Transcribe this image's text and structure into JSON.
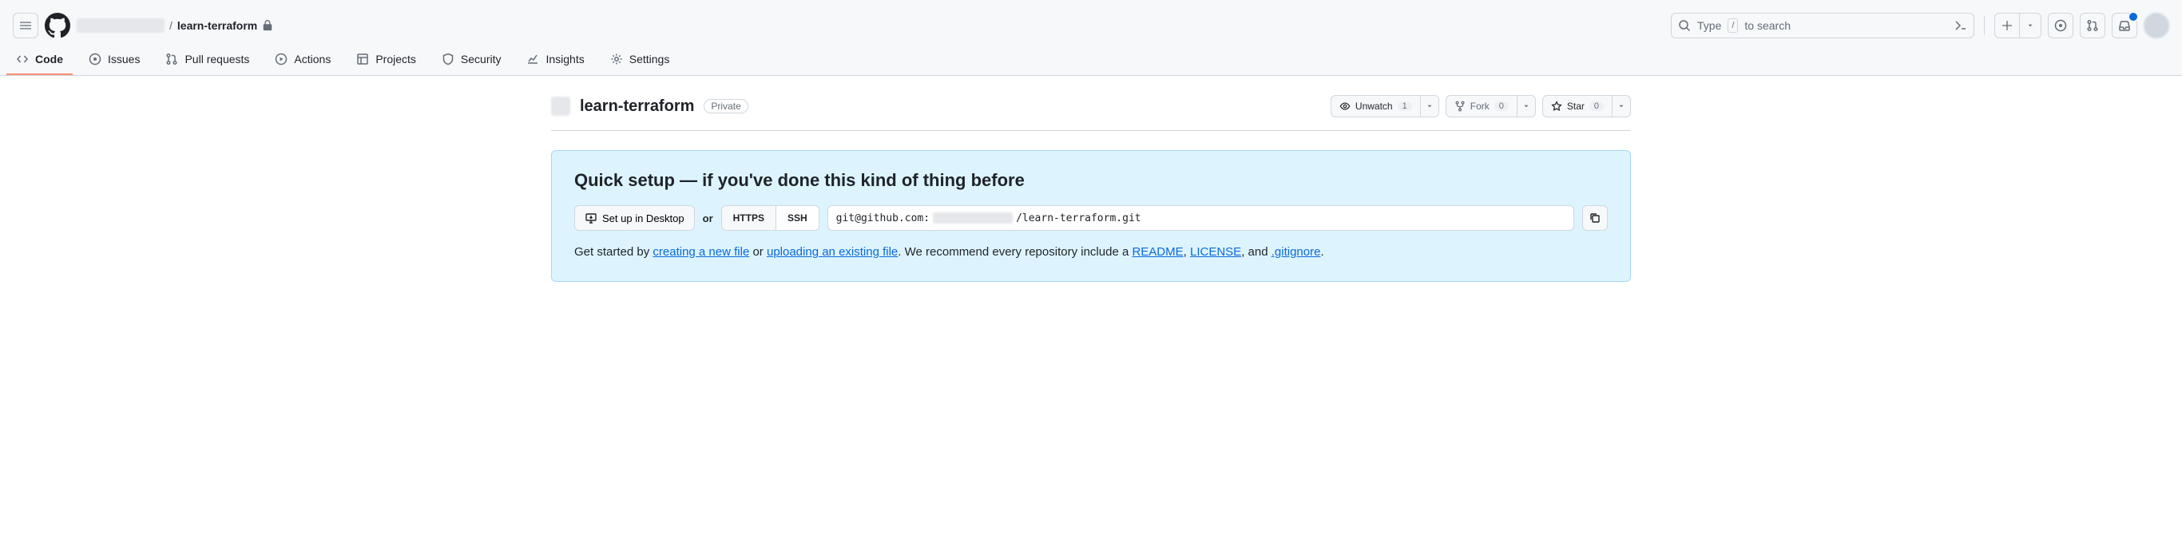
{
  "breadcrumb": {
    "repo": "learn-terraform"
  },
  "search": {
    "placeholder_pre": "Type",
    "placeholder_key": "/",
    "placeholder_post": "to search"
  },
  "tabs": {
    "code": "Code",
    "issues": "Issues",
    "pulls": "Pull requests",
    "actions": "Actions",
    "projects": "Projects",
    "security": "Security",
    "insights": "Insights",
    "settings": "Settings"
  },
  "repo": {
    "name": "learn-terraform",
    "visibility": "Private"
  },
  "actions": {
    "unwatch": "Unwatch",
    "watch_count": "1",
    "fork": "Fork",
    "fork_count": "0",
    "star": "Star",
    "star_count": "0"
  },
  "quick": {
    "title": "Quick setup — if you've done this kind of thing before",
    "desktop": "Set up in Desktop",
    "or": "or",
    "https": "HTTPS",
    "ssh": "SSH",
    "clone_prefix": "git@github.com:",
    "clone_suffix": "/learn-terraform.git",
    "foot_pre": "Get started by ",
    "link_new": "creating a new file",
    "foot_or": " or ",
    "link_upload": "uploading an existing file",
    "foot_mid": ". We recommend every repository include a ",
    "link_readme": "README",
    "foot_c1": ", ",
    "link_license": "LICENSE",
    "foot_c2": ", and ",
    "link_gitignore": ".gitignore",
    "foot_end": "."
  }
}
